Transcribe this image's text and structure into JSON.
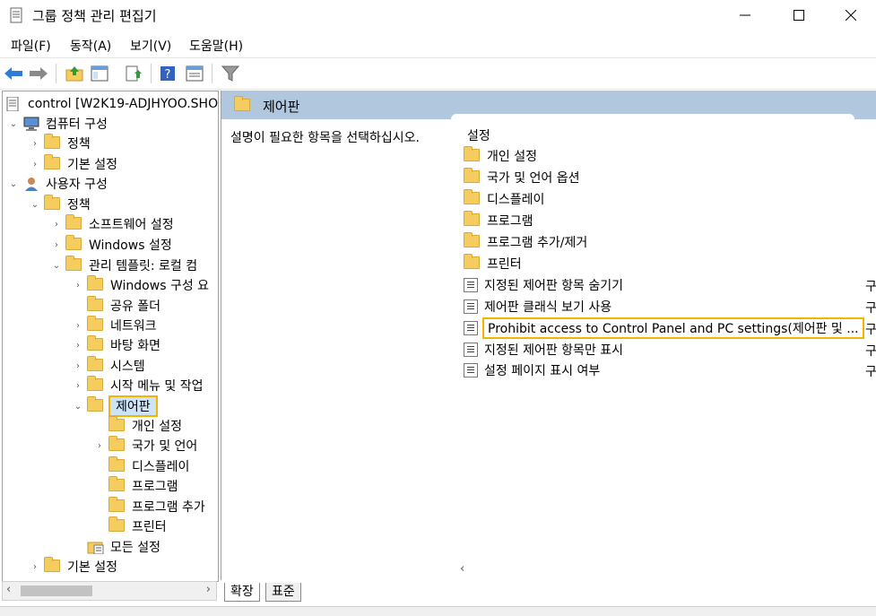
{
  "window": {
    "title": "그룹 정책 관리 편집기",
    "controls": {
      "minimize": "minimize-icon",
      "maximize": "maximize-icon",
      "close": "close-icon"
    }
  },
  "menu": [
    "파일(F)",
    "동작(A)",
    "보기(V)",
    "도움말(H)"
  ],
  "toolbar_icons": [
    "back-icon",
    "forward-icon",
    "up-folder-icon",
    "show-hide-tree-icon",
    "export-list-icon",
    "help-icon",
    "properties-icon",
    "filter-icon"
  ],
  "tree": {
    "root": "control [W2K19-ADJHYOO.SHO",
    "computer_config": "컴퓨터 구성",
    "cc_policy": "정책",
    "cc_prefs": "기본 설정",
    "user_config": "사용자 구성",
    "uc_policy": "정책",
    "software": "소프트웨어 설정",
    "windows_settings": "Windows 설정",
    "admin_templates": "관리 템플릿: 로컬 컴",
    "windows_components": "Windows 구성 요",
    "shared_folders": "공유 폴더",
    "network": "네트워크",
    "desktop": "바탕 화면",
    "system": "시스템",
    "start_menu": "시작 메뉴 및 작업",
    "control_panel": "제어판",
    "personalization": "개인 설정",
    "region_language": "국가 및 언어",
    "display": "디스플레이",
    "programs": "프로그램",
    "add_remove": "프로그램 추가",
    "printers": "프린터",
    "all_settings": "모든 설정",
    "uc_prefs": "기본 설정"
  },
  "right": {
    "header": "제어판",
    "description": "설명이 필요한 항목을 선택하십시오.",
    "column_setting": "설정",
    "folders": [
      "개인 설정",
      "국가 및 언어 옵션",
      "디스플레이",
      "프로그램",
      "프로그램 추가/제거",
      "프린터"
    ],
    "settings": [
      "지정된 제어판 항목 숨기기",
      "제어판 클래식 보기 사용",
      "Prohibit access to Control Panel and PC settings(제어판 및 ...",
      "지정된 제어판 항목만 표시",
      "설정 페이지 표시 여부"
    ],
    "state_cell": "구"
  },
  "tabs": {
    "extended": "확장",
    "standard": "표준"
  },
  "colors": {
    "header_bg": "#b1c7dd",
    "highlight": "#f5b400",
    "folder": "#f5cd5f"
  }
}
